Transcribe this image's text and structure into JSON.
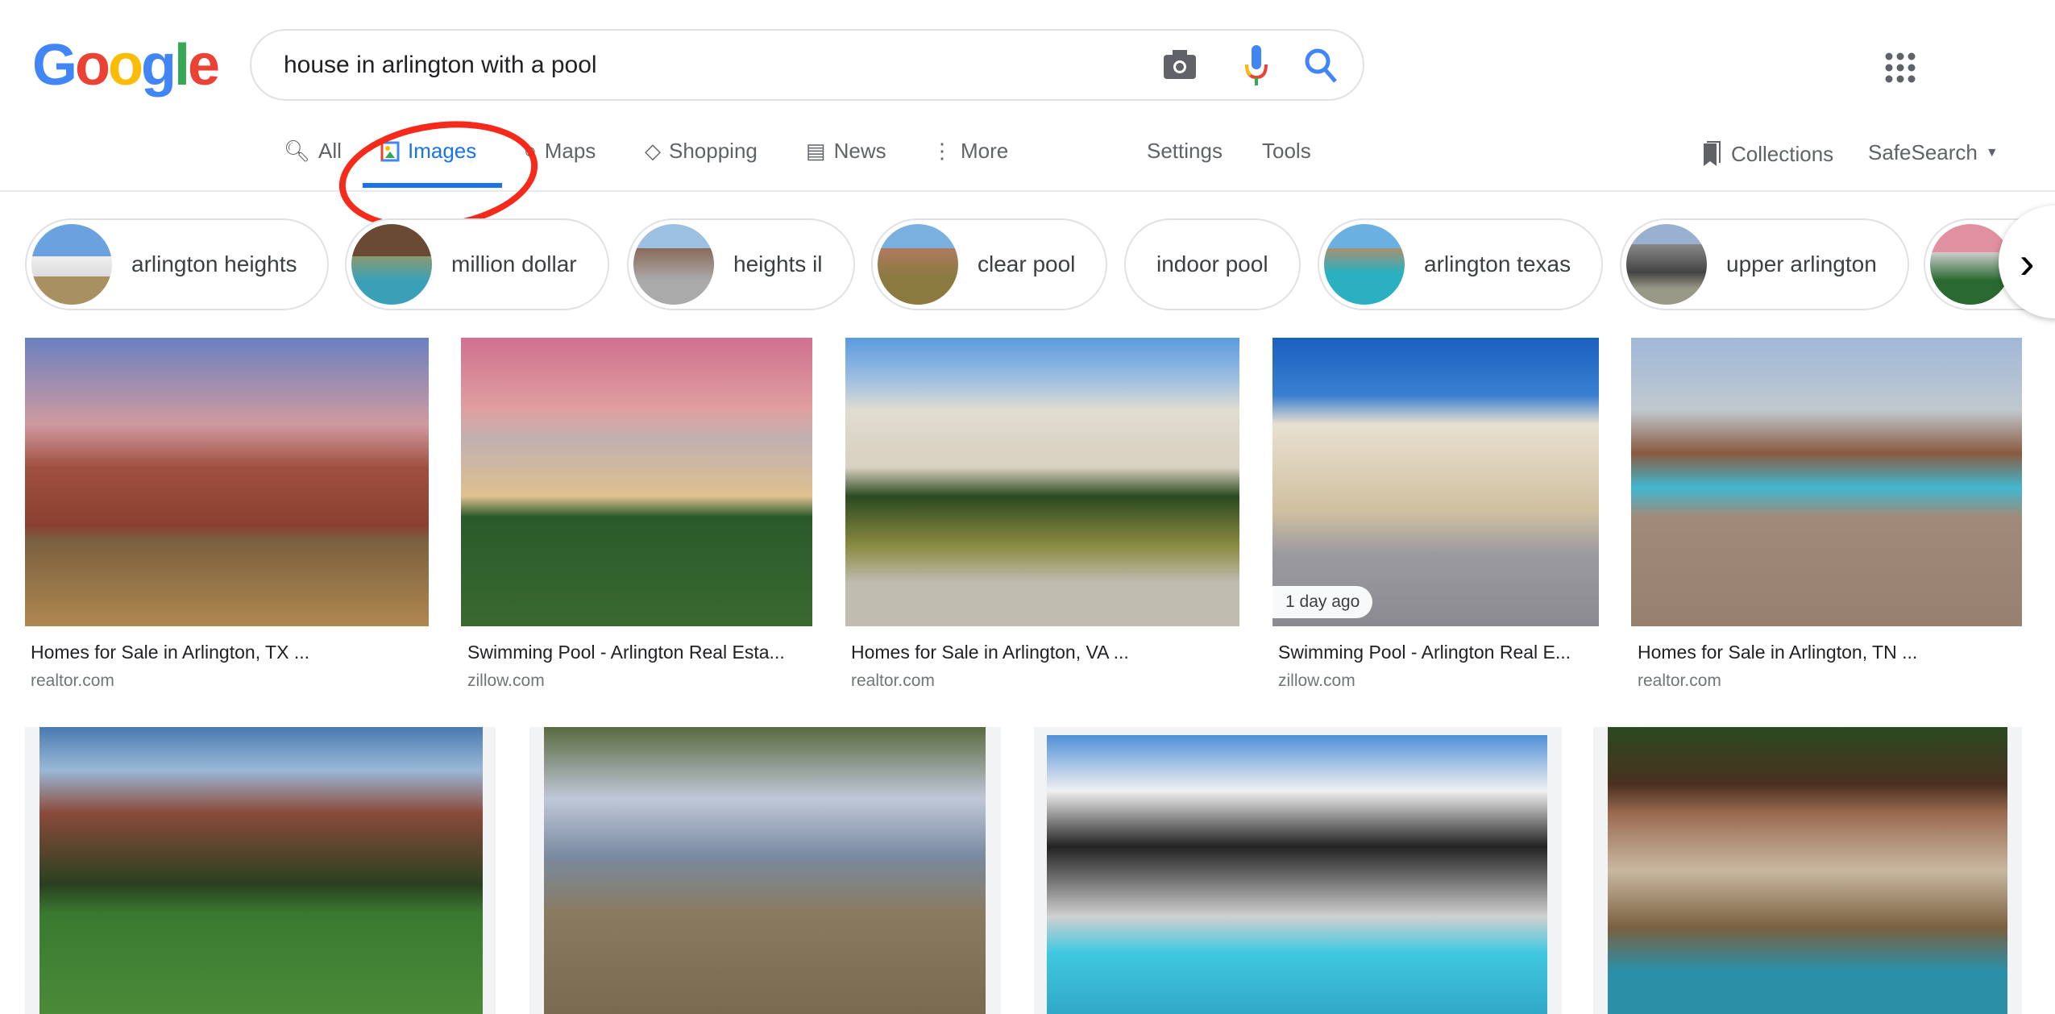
{
  "header": {
    "logo": "Google",
    "query": "house in arlington with a pool",
    "icons": [
      "camera-icon",
      "mic-icon",
      "search-icon",
      "apps-grid-icon"
    ]
  },
  "tabs": [
    {
      "label": "All",
      "icon": "search-icon"
    },
    {
      "label": "Images",
      "icon": "image-icon",
      "active": true
    },
    {
      "label": "Maps",
      "icon": "map-pin-icon"
    },
    {
      "label": "Shopping",
      "icon": "tag-icon"
    },
    {
      "label": "News",
      "icon": "news-icon"
    },
    {
      "label": "More",
      "icon": "more-vert-icon"
    }
  ],
  "tools": {
    "settings": "Settings",
    "tools": "Tools",
    "collections": "Collections",
    "safesearch": "SafeSearch"
  },
  "chips": [
    "arlington heights",
    "million dollar",
    "heights il",
    "clear pool",
    "indoor pool",
    "arlington texas",
    "upper arlington"
  ],
  "results_row1": [
    {
      "title": "Homes for Sale in Arlington, TX ...",
      "source": "realtor.com"
    },
    {
      "title": "Swimming Pool - Arlington Real Esta...",
      "source": "zillow.com"
    },
    {
      "title": "Homes for Sale in Arlington, VA ...",
      "source": "realtor.com"
    },
    {
      "title": "Swimming Pool - Arlington Real E...",
      "source": "zillow.com",
      "badge": "1 day ago"
    },
    {
      "title": "Homes for Sale in Arlington, TN ...",
      "source": "realtor.com"
    }
  ],
  "colors": {
    "accent": "#1a73e8",
    "annotation": "#f52a1a"
  }
}
